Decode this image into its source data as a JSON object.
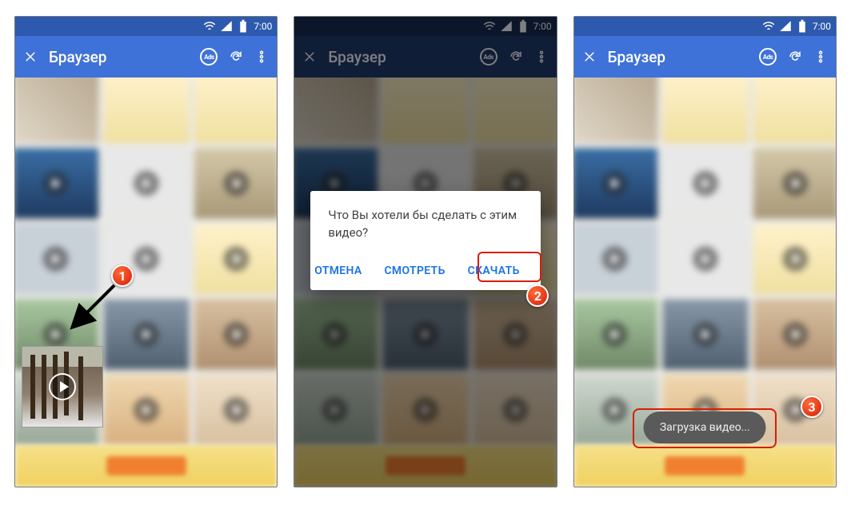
{
  "status": {
    "time": "7:00"
  },
  "appbar": {
    "title": "Браузер",
    "ads": "Ads"
  },
  "dialog": {
    "message": "Что Вы хотели бы сделать с этим видео?",
    "cancel": "ОТМЕНА",
    "watch": "СМОТРЕТЬ",
    "download": "СКАЧАТЬ"
  },
  "toast": {
    "text": "Загрузка видео..."
  },
  "steps": {
    "s1": "1",
    "s2": "2",
    "s3": "3"
  }
}
